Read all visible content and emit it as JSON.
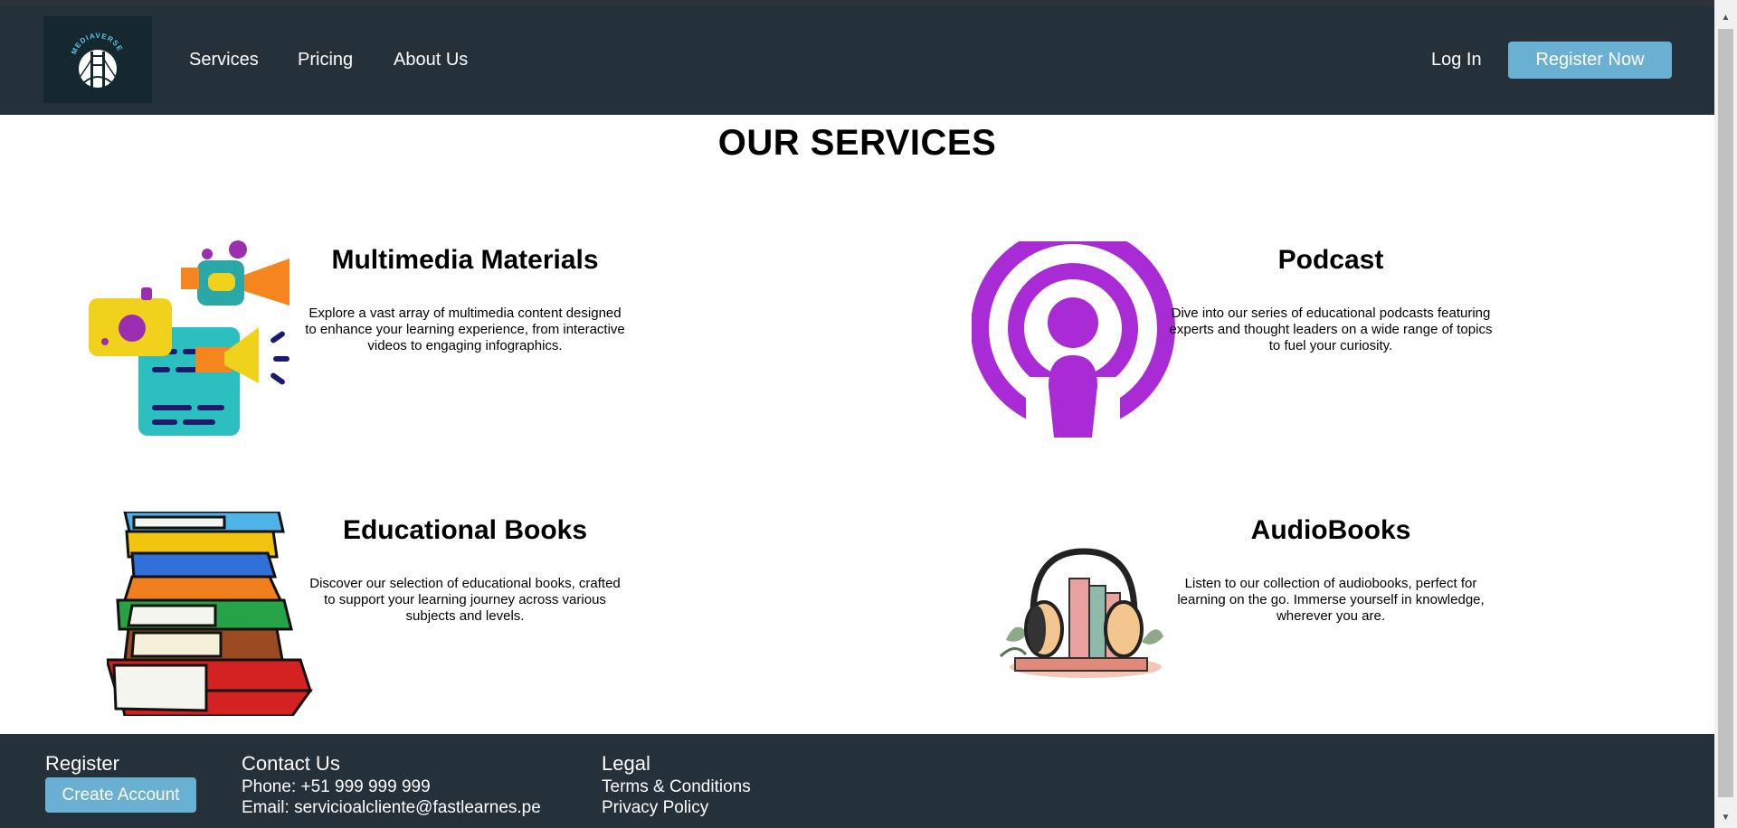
{
  "header": {
    "logo_text": "MEDIAVERSE",
    "nav": [
      {
        "label": "Services"
      },
      {
        "label": "Pricing"
      },
      {
        "label": "About Us"
      }
    ],
    "login_label": "Log In",
    "register_label": "Register Now"
  },
  "main": {
    "title": "OUR SERVICES",
    "services": [
      {
        "title": "Multimedia Materials",
        "description": "Explore a vast array of multimedia content designed to enhance your learning experience, from interactive videos to engaging infographics.",
        "icon": "multimedia-icon"
      },
      {
        "title": "Podcast",
        "description": "Dive into our series of educational podcasts featuring experts and thought leaders on a wide range of topics to fuel your curiosity.",
        "icon": "podcast-icon"
      },
      {
        "title": "Educational Books",
        "description": "Discover our selection of educational books, crafted to support your learning journey across various subjects and levels.",
        "icon": "books-icon"
      },
      {
        "title": "AudioBooks",
        "description": "Listen to our collection of audiobooks, perfect for learning on the go. Immerse yourself in knowledge, wherever you are.",
        "icon": "audiobook-icon"
      }
    ]
  },
  "footer": {
    "register": {
      "heading": "Register",
      "button_label": "Create Account"
    },
    "contact": {
      "heading": "Contact Us",
      "phone": "Phone: +51 999 999 999",
      "email": "Email: servicioalcliente@fastlearnes.pe"
    },
    "legal": {
      "heading": "Legal",
      "terms": "Terms & Conditions",
      "privacy": "Privacy Policy"
    }
  },
  "colors": {
    "header_bg": "#24313b",
    "accent": "#6ab0d2",
    "podcast_purple": "#a82bd6"
  }
}
